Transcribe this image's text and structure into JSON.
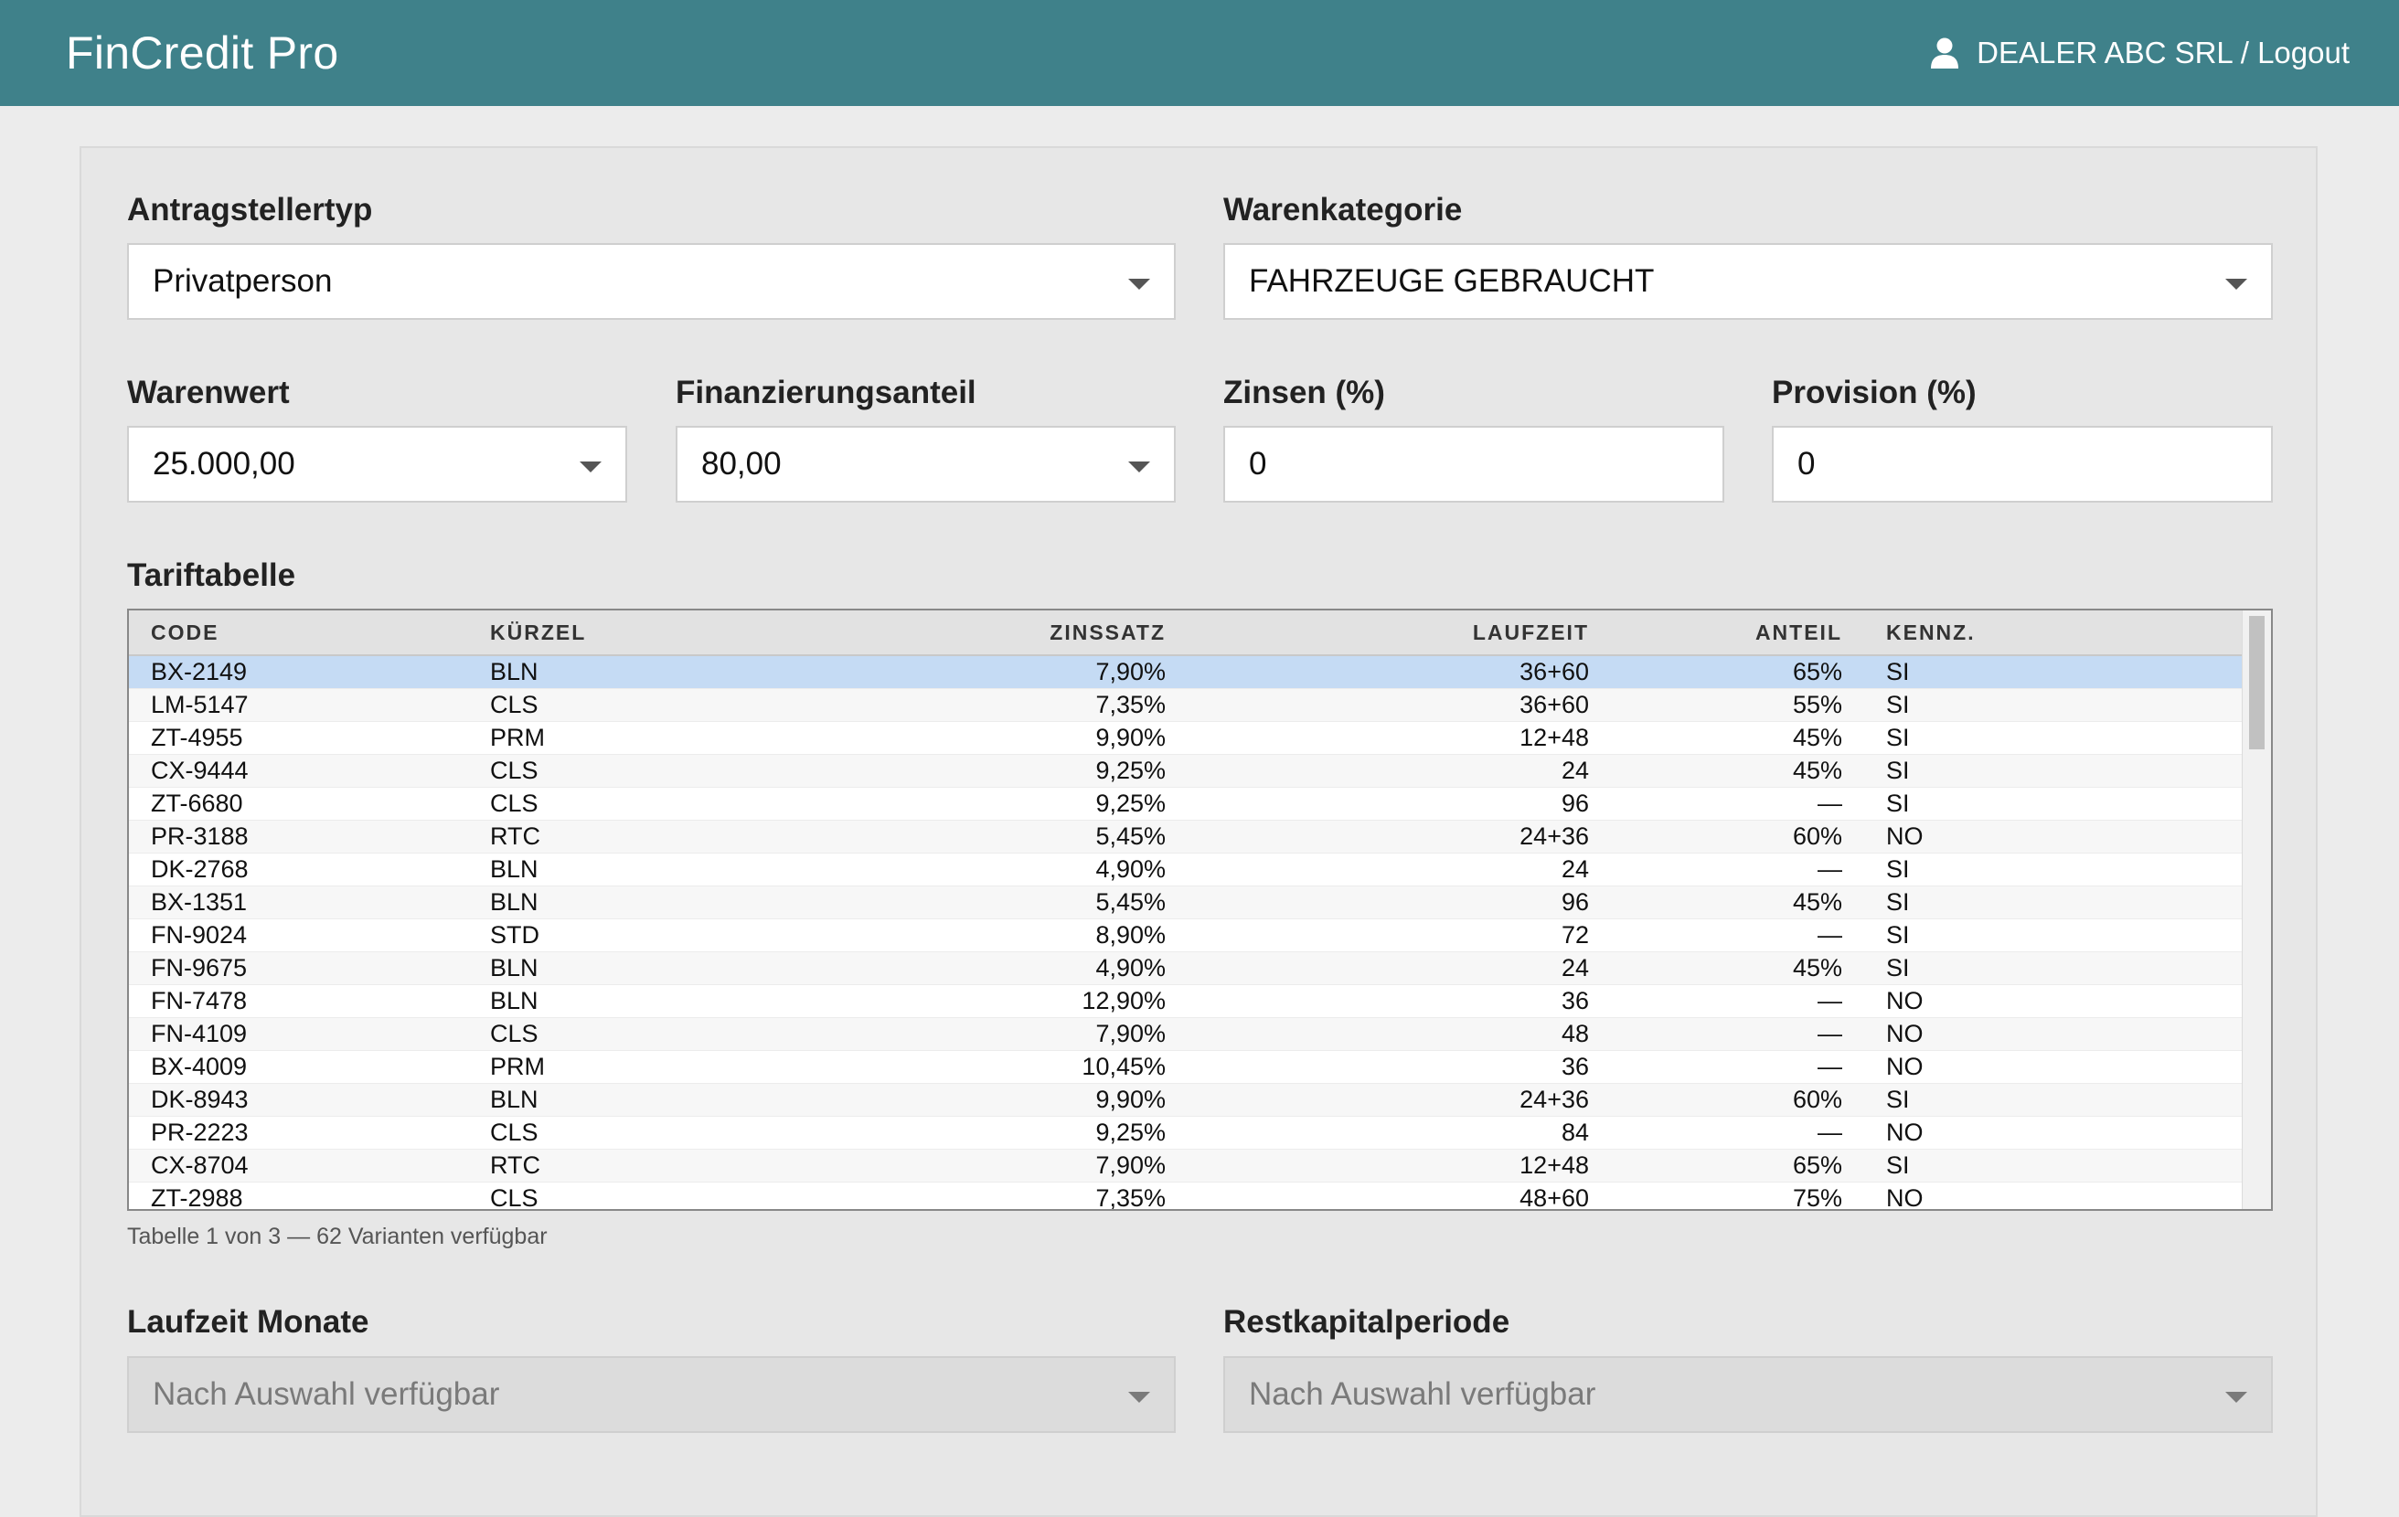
{
  "header": {
    "brand": "FinCredit Pro",
    "user_label": "DEALER ABC SRL / Logout",
    "user_icon": "user-icon"
  },
  "form": {
    "applicant_type": {
      "label": "Antragstellertyp",
      "value": "Privatperson"
    },
    "goods_category": {
      "label": "Warenkategorie",
      "value": "FAHRZEUGE GEBRAUCHT"
    },
    "goods_value": {
      "label": "Warenwert",
      "value": "25.000,00"
    },
    "financing_share": {
      "label": "Finanzierungsanteil",
      "value": "80,00"
    },
    "interest": {
      "label": "Zinsen (%)",
      "value": "0"
    },
    "commission": {
      "label": "Provision (%)",
      "value": "0"
    }
  },
  "tariff": {
    "title": "Tariftabelle",
    "columns": [
      "CODE",
      "KÜRZEL",
      "ZINSSATZ",
      "LAUFZEIT",
      "ANTEIL",
      "KENNZ."
    ],
    "rows": [
      [
        "BX-2149",
        "BLN",
        "7,90%",
        "36+60",
        "65%",
        "SI"
      ],
      [
        "LM-5147",
        "CLS",
        "7,35%",
        "36+60",
        "55%",
        "SI"
      ],
      [
        "ZT-4955",
        "PRM",
        "9,90%",
        "12+48",
        "45%",
        "SI"
      ],
      [
        "CX-9444",
        "CLS",
        "9,25%",
        "24",
        "45%",
        "SI"
      ],
      [
        "ZT-6680",
        "CLS",
        "9,25%",
        "96",
        "—",
        "SI"
      ],
      [
        "PR-3188",
        "RTC",
        "5,45%",
        "24+36",
        "60%",
        "NO"
      ],
      [
        "DK-2768",
        "BLN",
        "4,90%",
        "24",
        "—",
        "SI"
      ],
      [
        "BX-1351",
        "BLN",
        "5,45%",
        "96",
        "45%",
        "SI"
      ],
      [
        "FN-9024",
        "STD",
        "8,90%",
        "72",
        "—",
        "SI"
      ],
      [
        "FN-9675",
        "BLN",
        "4,90%",
        "24",
        "45%",
        "SI"
      ],
      [
        "FN-7478",
        "BLN",
        "12,90%",
        "36",
        "—",
        "NO"
      ],
      [
        "FN-4109",
        "CLS",
        "7,90%",
        "48",
        "—",
        "NO"
      ],
      [
        "BX-4009",
        "PRM",
        "10,45%",
        "36",
        "—",
        "NO"
      ],
      [
        "DK-8943",
        "BLN",
        "9,90%",
        "24+36",
        "60%",
        "SI"
      ],
      [
        "PR-2223",
        "CLS",
        "9,25%",
        "84",
        "—",
        "NO"
      ],
      [
        "CX-8704",
        "RTC",
        "7,90%",
        "12+48",
        "65%",
        "SI"
      ],
      [
        "ZT-2988",
        "CLS",
        "7,35%",
        "48+60",
        "75%",
        "NO"
      ]
    ],
    "selected_index": 0,
    "footnote": "Tabelle 1 von 3 — 62 Varianten verfügbar"
  },
  "bottom": {
    "term": {
      "label": "Laufzeit Monate",
      "value": "Nach Auswahl verfügbar"
    },
    "residual": {
      "label": "Restkapitalperiode",
      "value": "Nach Auswahl verfügbar"
    }
  },
  "colors": {
    "header_bg": "#3f818a",
    "selected_row": "#c5dbf4"
  }
}
